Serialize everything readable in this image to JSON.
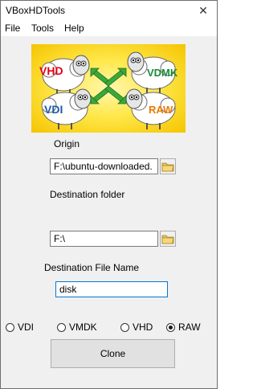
{
  "window": {
    "title": "VBoxHDTools",
    "close_glyph": "✕"
  },
  "menu": {
    "items": [
      "File",
      "Tools",
      "Help"
    ]
  },
  "banner": {
    "labels": [
      "VHD",
      "VDMK",
      "VDI",
      "RAW"
    ]
  },
  "origin": {
    "label": "Origin",
    "value": "F:\\ubuntu-downloaded.",
    "browse_icon": "folder-icon"
  },
  "destination_folder": {
    "label": "Destination folder",
    "value": "F:\\",
    "browse_icon": "folder-icon"
  },
  "destination_file": {
    "label": "Destination File Name",
    "value": "disk"
  },
  "formats": {
    "options": [
      "VDI",
      "VMDK",
      "VHD",
      "RAW"
    ],
    "selected": "RAW"
  },
  "actions": {
    "clone_label": "Clone"
  }
}
